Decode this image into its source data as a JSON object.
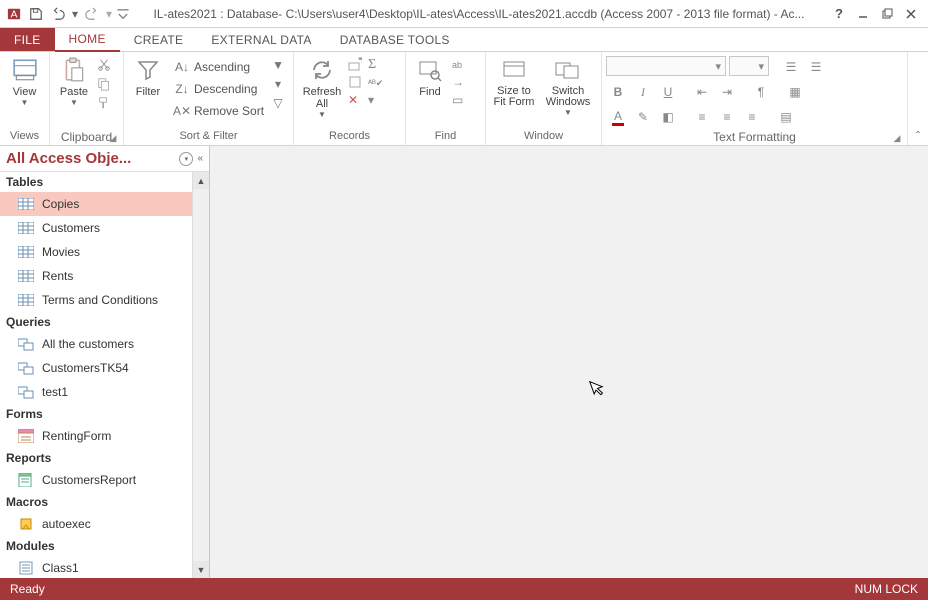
{
  "title": "IL-ates2021 : Database- C:\\Users\\user4\\Desktop\\IL-ates\\Access\\IL-ates2021.accdb (Access 2007 - 2013 file format) - Ac...",
  "tabs": {
    "file": "FILE",
    "home": "HOME",
    "create": "CREATE",
    "external": "EXTERNAL DATA",
    "dbtools": "DATABASE TOOLS"
  },
  "ribbon": {
    "views": {
      "view": "View",
      "label": "Views"
    },
    "clipboard": {
      "paste": "Paste",
      "label": "Clipboard"
    },
    "sortfilter": {
      "filter": "Filter",
      "asc": "Ascending",
      "desc": "Descending",
      "remove": "Remove Sort",
      "label": "Sort & Filter"
    },
    "records": {
      "refresh": "Refresh All",
      "label": "Records"
    },
    "find": {
      "find": "Find",
      "label": "Find"
    },
    "window": {
      "size": "Size to Fit Form",
      "switch": "Switch Windows",
      "label": "Window"
    },
    "textfmt": {
      "label": "Text Formatting"
    }
  },
  "nav": {
    "header": "All Access Obje...",
    "sections": {
      "tables": {
        "label": "Tables",
        "items": [
          "Copies",
          "Customers",
          "Movies",
          "Rents",
          "Terms and Conditions"
        ]
      },
      "queries": {
        "label": "Queries",
        "items": [
          "All the customers",
          "CustomersTK54",
          "test1"
        ]
      },
      "forms": {
        "label": "Forms",
        "items": [
          "RentingForm"
        ]
      },
      "reports": {
        "label": "Reports",
        "items": [
          "CustomersReport"
        ]
      },
      "macros": {
        "label": "Macros",
        "items": [
          "autoexec"
        ]
      },
      "modules": {
        "label": "Modules",
        "items": [
          "Class1"
        ]
      }
    }
  },
  "status": {
    "ready": "Ready",
    "numlock": "NUM LOCK"
  }
}
